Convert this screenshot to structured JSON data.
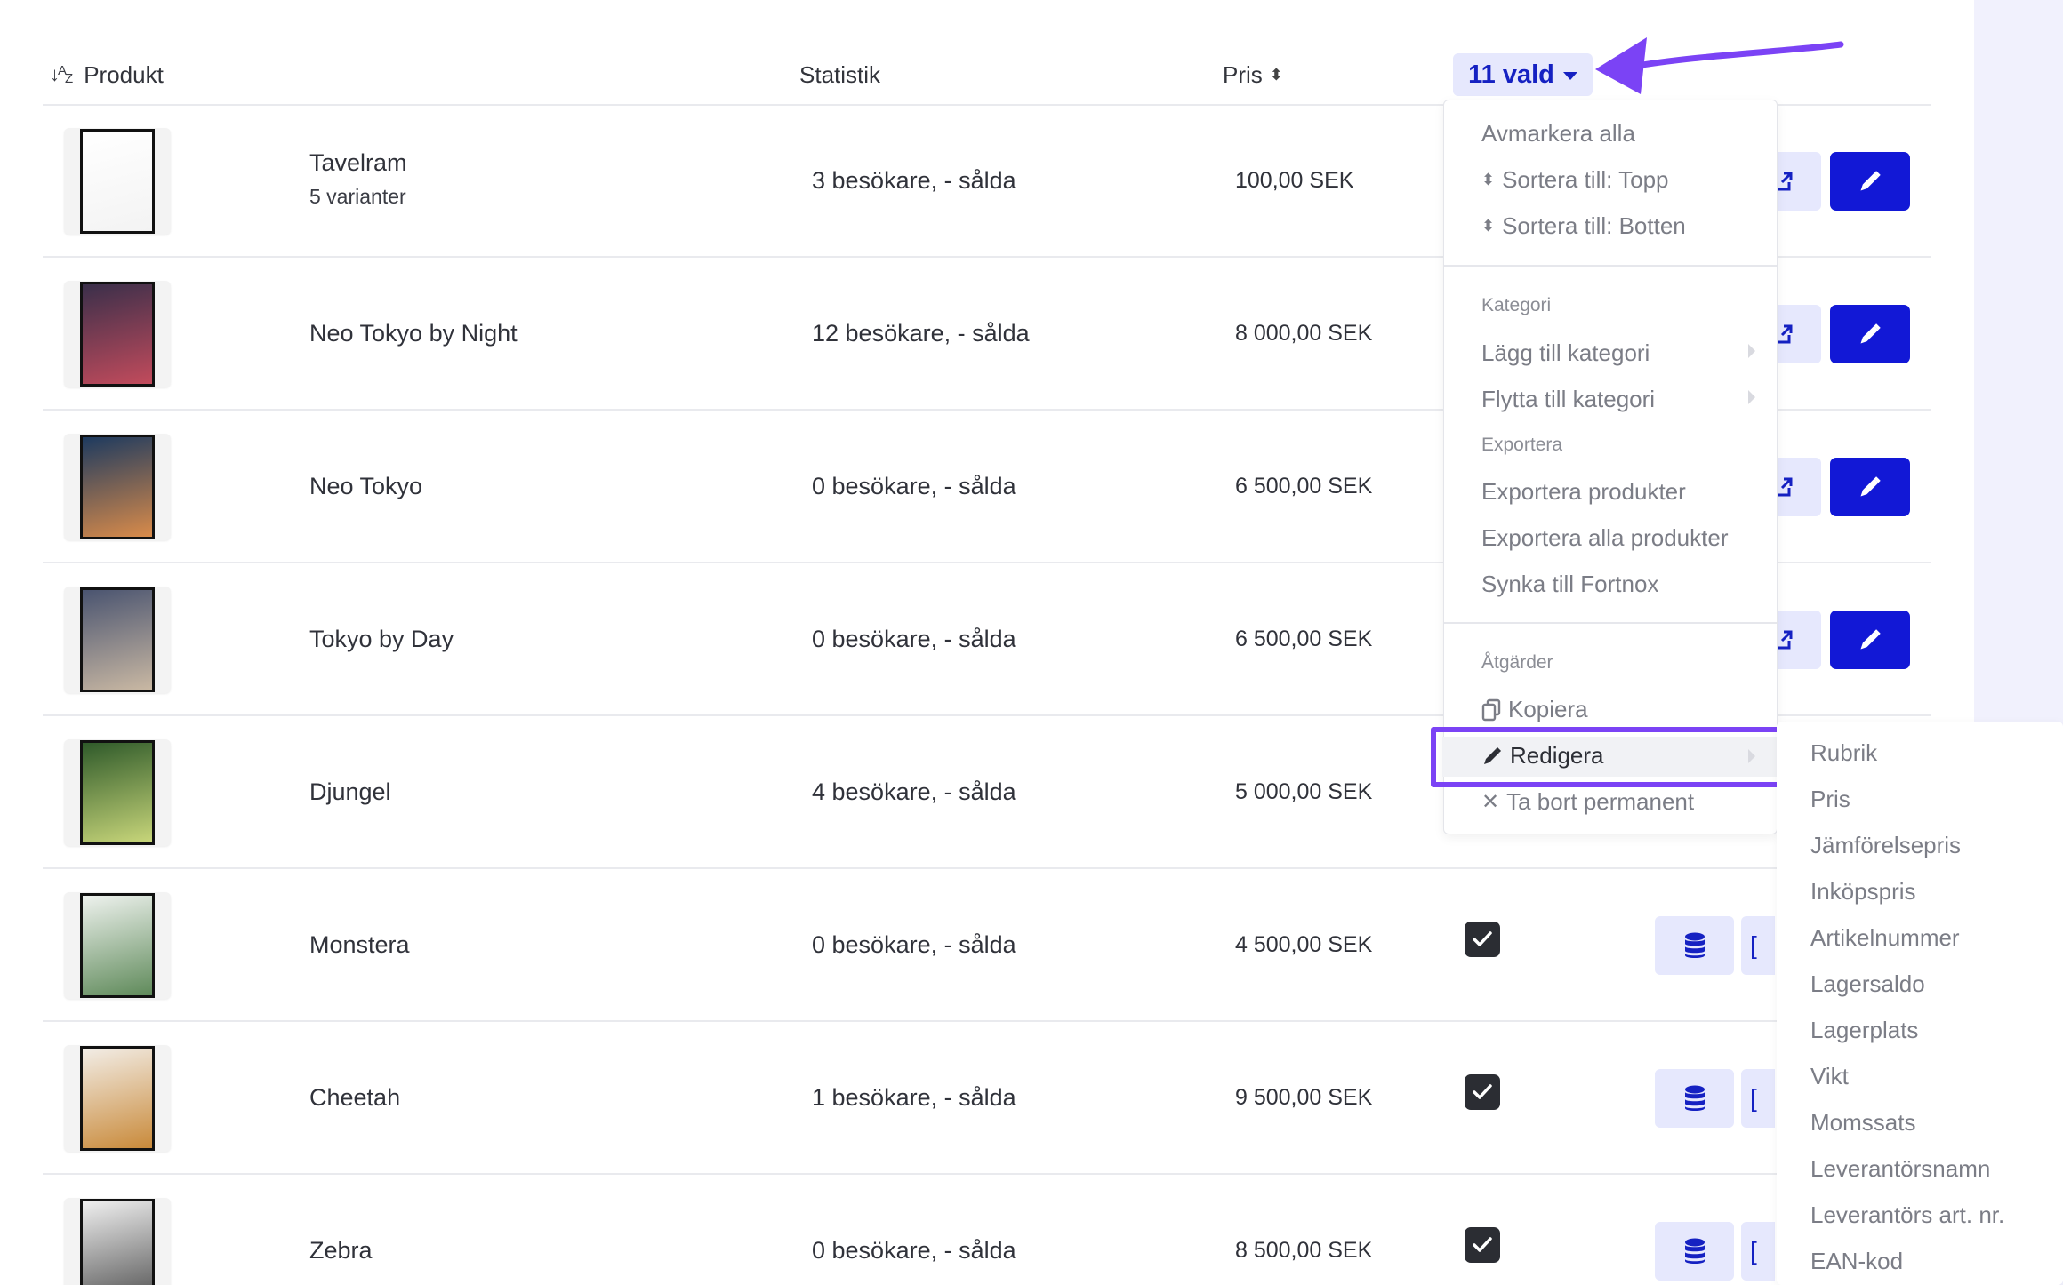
{
  "header": {
    "produkt_label": "Produkt",
    "statistik_label": "Statistik",
    "pris_label": "Pris",
    "selection_label": "11 vald"
  },
  "products": [
    {
      "name": "Tavelram",
      "sub": "5 varianter",
      "stats": "3 besökare, - sålda",
      "price": "100,00 SEK"
    },
    {
      "name": "Neo Tokyo by Night",
      "stats": "12 besökare, - sålda",
      "price": "8 000,00 SEK"
    },
    {
      "name": "Neo Tokyo",
      "stats": "0 besökare, - sålda",
      "price": "6 500,00 SEK"
    },
    {
      "name": "Tokyo by Day",
      "stats": "0 besökare, - sålda",
      "price": "6 500,00 SEK"
    },
    {
      "name": "Djungel",
      "stats": "4 besökare, - sålda",
      "price": "5 000,00 SEK"
    },
    {
      "name": "Monstera",
      "stats": "0 besökare, - sålda",
      "price": "4 500,00 SEK"
    },
    {
      "name": "Cheetah",
      "stats": "1 besökare, - sålda",
      "price": "9 500,00 SEK"
    },
    {
      "name": "Zebra",
      "stats": "0 besökare, - sålda",
      "price": "8 500,00 SEK"
    }
  ],
  "menu": {
    "deselect_all": "Avmarkera alla",
    "sort_top": "Sortera till: Topp",
    "sort_bottom": "Sortera till: Botten",
    "category_heading": "Kategori",
    "add_category": "Lägg till kategori",
    "move_category": "Flytta till kategori",
    "export_heading": "Exportera",
    "export_products": "Exportera produkter",
    "export_all": "Exportera alla produkter",
    "sync_fortnox": "Synka till Fortnox",
    "actions_heading": "Åtgärder",
    "copy": "Kopiera",
    "edit": "Redigera",
    "delete": "Ta bort permanent"
  },
  "submenu": [
    "Rubrik",
    "Pris",
    "Jämförelsepris",
    "Inköpspris",
    "Artikelnummer",
    "Lagersaldo",
    "Lagerplats",
    "Vikt",
    "Momssats",
    "Leverantörsnamn",
    "Leverantörs art. nr.",
    "EAN-kod"
  ],
  "colors": {
    "accent": "#1218d6",
    "accent_light": "#e6e8fd",
    "highlight": "#7b43f5"
  }
}
